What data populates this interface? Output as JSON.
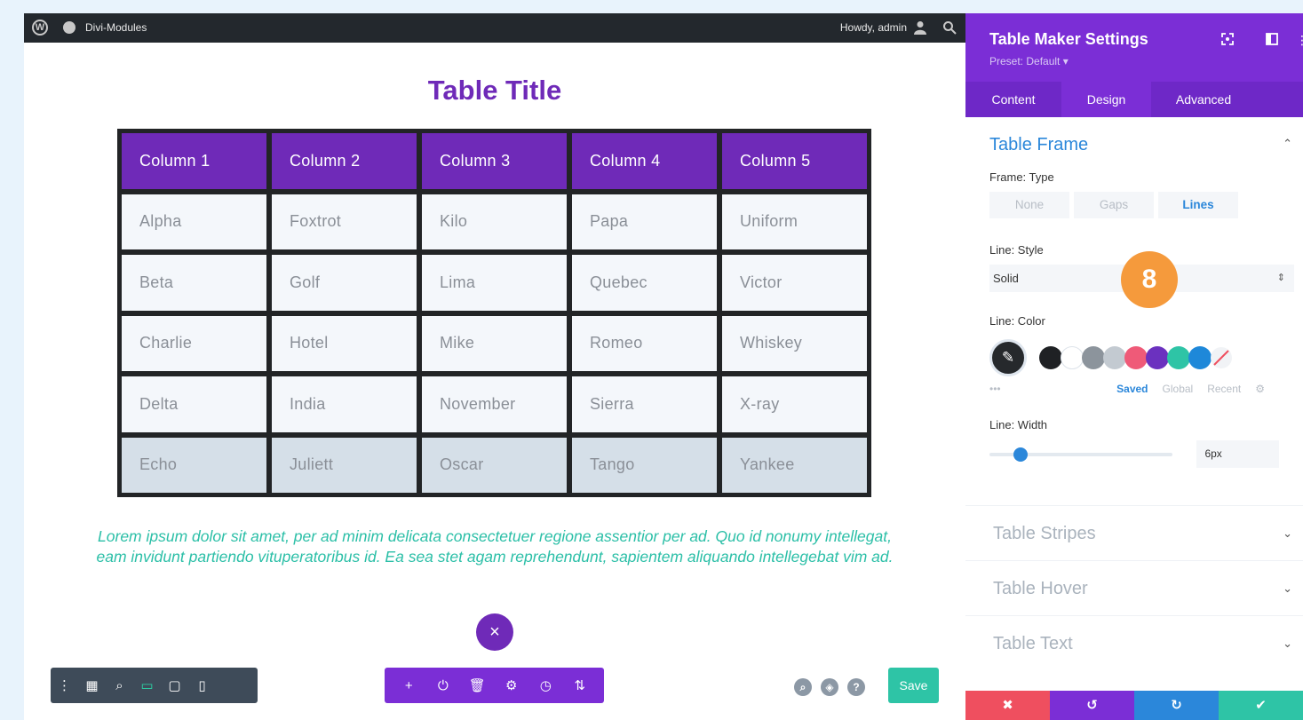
{
  "adminbar": {
    "site_name": "Divi-Modules",
    "greeting": "Howdy, admin"
  },
  "table": {
    "title": "Table Title",
    "headers": [
      "Column 1",
      "Column 2",
      "Column 3",
      "Column 4",
      "Column 5"
    ],
    "rows": [
      [
        "Alpha",
        "Foxtrot",
        "Kilo",
        "Papa",
        "Uniform"
      ],
      [
        "Beta",
        "Golf",
        "Lima",
        "Quebec",
        "Victor"
      ],
      [
        "Charlie",
        "Hotel",
        "Mike",
        "Romeo",
        "Whiskey"
      ],
      [
        "Delta",
        "India",
        "November",
        "Sierra",
        "X-ray"
      ],
      [
        "Echo",
        "Juliett",
        "Oscar",
        "Tango",
        "Yankee"
      ]
    ]
  },
  "lorem": "Lorem ipsum dolor sit amet, per ad minim delicata consectetuer regione assentior per ad. Quo id nonumy intellegat, eam invidunt partiendo vituperatoribus id. Ea sea stet agam reprehendunt, sapientem aliquando intellegebat vim ad.",
  "builder": {
    "close_glyph": "×",
    "save_label": "Save",
    "left_toolbar": [
      "⋮",
      "▦",
      "⌕",
      "▭",
      "▢",
      "▯"
    ],
    "center_toolbar": [
      "+",
      "⏻",
      "🗑",
      "⚙",
      "◷",
      "⇅"
    ],
    "round_buttons": [
      "⌕",
      "◈",
      "?"
    ]
  },
  "panel": {
    "title": "Table Maker Settings",
    "preset": "Preset: Default ▾",
    "tabs": [
      "Content",
      "Design",
      "Advanced"
    ],
    "active_tab": "Design",
    "section_frame": {
      "title": "Table Frame",
      "frame_type_label": "Frame: Type",
      "frame_types": [
        "None",
        "Gaps",
        "Lines"
      ],
      "frame_type_selected": "Lines",
      "line_style_label": "Line: Style",
      "line_style_value": "Solid",
      "line_color_label": "Line: Color",
      "swatches": [
        "#1f2124",
        "#ffffff",
        "#8c949c",
        "#c3cad1",
        "#ef5a78",
        "#6b31bf",
        "#2ec4a6",
        "#1e88d9"
      ],
      "color_tabs": [
        "Saved",
        "Global",
        "Recent"
      ],
      "line_width_label": "Line: Width",
      "line_width_value": "6px"
    },
    "collapsed_sections": [
      "Table Stripes",
      "Table Hover",
      "Table Text"
    ],
    "badge": "8",
    "footer_icons": [
      "✖",
      "↺",
      "↻",
      "✔"
    ],
    "footer_colors": [
      "#ef4f5f",
      "#7b2ed6",
      "#2b87da",
      "#2ec4a6"
    ]
  }
}
